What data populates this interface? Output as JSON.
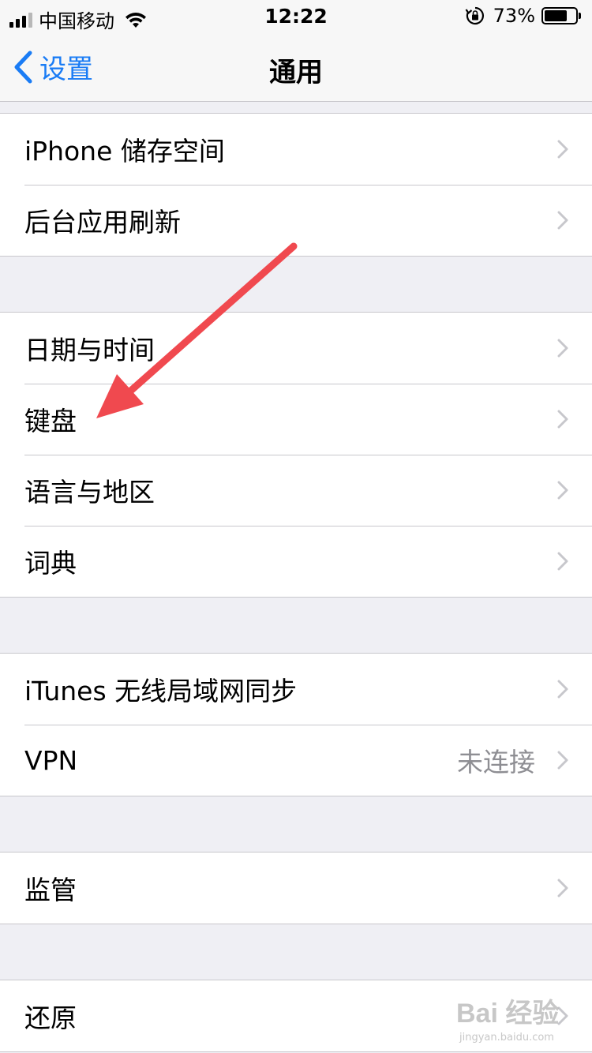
{
  "status_bar": {
    "carrier": "中国移动",
    "time": "12:22",
    "battery_percent": "73%",
    "battery_level": 0.73,
    "signal_icon": "signal-bars-icon",
    "wifi_icon": "wifi-icon",
    "rotation_lock_icon": "rotation-lock-icon",
    "battery_icon": "battery-icon"
  },
  "nav": {
    "back_label": "设置",
    "title": "通用"
  },
  "sections": [
    {
      "rows": [
        {
          "label": "iPhone 储存空间"
        },
        {
          "label": "后台应用刷新"
        }
      ]
    },
    {
      "rows": [
        {
          "label": "日期与时间"
        },
        {
          "label": "键盘"
        },
        {
          "label": "语言与地区"
        },
        {
          "label": "词典"
        }
      ]
    },
    {
      "rows": [
        {
          "label": "iTunes 无线局域网同步"
        },
        {
          "label": "VPN",
          "value": "未连接"
        }
      ]
    },
    {
      "rows": [
        {
          "label": "监管"
        }
      ]
    },
    {
      "rows": [
        {
          "label": "还原"
        }
      ]
    }
  ],
  "watermark": {
    "text": "Bai 经验",
    "sub": "jingyan.baidu.com"
  },
  "colors": {
    "accent": "#1a7cf5",
    "background": "#efeff4",
    "annotation_arrow": "#f0494f"
  }
}
